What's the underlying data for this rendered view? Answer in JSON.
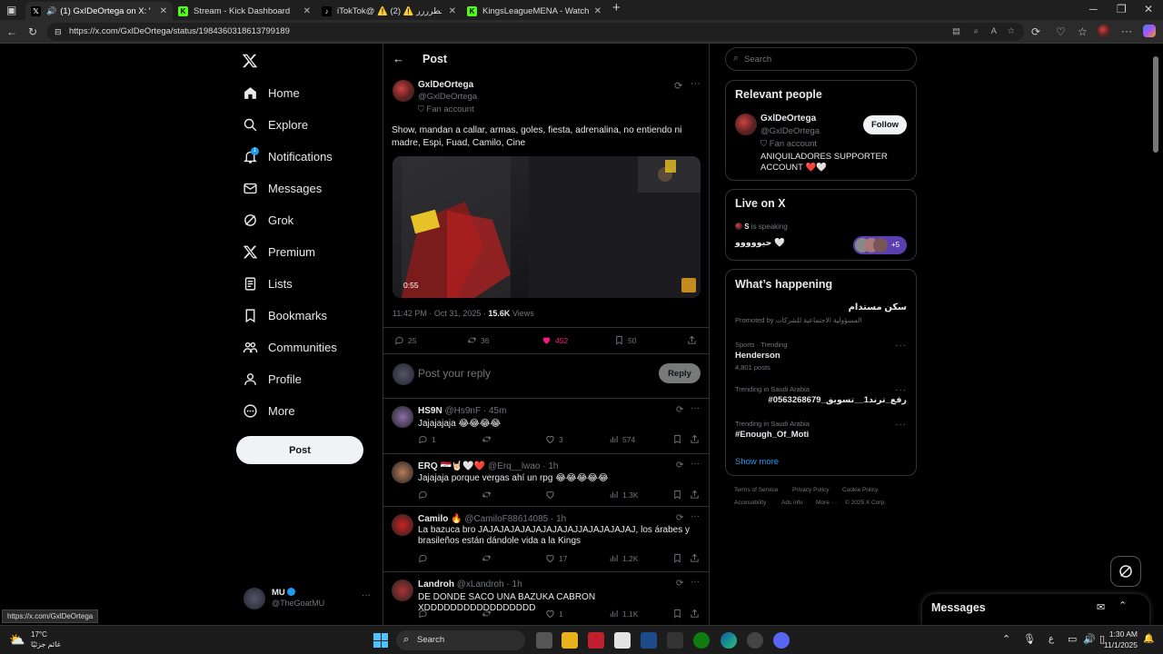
{
  "browser": {
    "tabs": [
      {
        "label": "(1) GxIDeOrtega on X: \"Show",
        "active": true
      },
      {
        "label": "Stream - Kick Dashboard",
        "active": false
      },
      {
        "label": "iTokTok@ ⚠️ يبني انا خطرررر ⚠️ (2)",
        "active": false
      },
      {
        "label": "KingsLeagueMENA - Watch the V",
        "active": false
      }
    ],
    "new_tab": "+",
    "url": "https://x.com/GxlDeOrtega/status/1984360318613799189",
    "status_url": "https://x.com/GxlDeOrtega"
  },
  "nav": {
    "items": [
      {
        "label": "Home",
        "icon": "home-icon"
      },
      {
        "label": "Explore",
        "icon": "search-icon"
      },
      {
        "label": "Notifications",
        "icon": "bell-icon",
        "badge": "1"
      },
      {
        "label": "Messages",
        "icon": "envelope-icon"
      },
      {
        "label": "Grok",
        "icon": "grok-icon"
      },
      {
        "label": "Premium",
        "icon": "x-logo-icon"
      },
      {
        "label": "Lists",
        "icon": "list-icon"
      },
      {
        "label": "Bookmarks",
        "icon": "bookmark-icon"
      },
      {
        "label": "Communities",
        "icon": "people-icon"
      },
      {
        "label": "Profile",
        "icon": "person-icon"
      },
      {
        "label": "More",
        "icon": "more-circle-icon"
      }
    ],
    "post_button": "Post",
    "account": {
      "name": "MU",
      "handle": "@TheGoatMU"
    }
  },
  "post": {
    "header_title": "Post",
    "author_name": "GxlDeOrtega",
    "author_handle": "@GxlDeOrtega",
    "author_tag": "Fan account",
    "text": "Show, mandan a callar, armas, goles, fiesta, adrenalina, no entiendo ni madre, Espi, Fuad, Camilo, Cine",
    "video_time": "0:55",
    "timestamp": "11:42 PM · Oct 31, 2025 · ",
    "views_count": "15.6K",
    "views_label": " Views",
    "replies": "25",
    "reposts": "36",
    "likes": "452",
    "bookmarks": "50",
    "reply_placeholder": "Post your reply",
    "reply_button": "Reply",
    "like_color": "#f91880"
  },
  "replies": [
    {
      "name": "HS9N",
      "handle": "@Hs9nF · 45m",
      "text": "Jajajajaja 😂😂😂😂",
      "replies": "1",
      "reposts": "",
      "likes": "3",
      "views": "574"
    },
    {
      "name": "ERQ 🇮🇶🤘🏻🤍❤️",
      "handle": "@Erq__lwao · 1h",
      "text": "Jajajaja porque vergas ahí un rpg 😂😂😂😂😂",
      "replies": "",
      "reposts": "",
      "likes": "",
      "views": "1.3K"
    },
    {
      "name": "Camilo 🔥",
      "handle": "@CamiloF88614085 · 1h",
      "text": "La bazuca bro JAJAJAJAJAJAJAJAJAJJAJAJAJAJAJ, los árabes y brasileños están dándole vida a la Kings",
      "replies": "",
      "reposts": "",
      "likes": "17",
      "views": "1.2K"
    },
    {
      "name": "Landroh",
      "handle": "@xLandroh · 1h",
      "text": "DE DONDE SACO UNA BAZUKA CABRON XDDDDDDDDDDDDDDDDD",
      "replies": "",
      "reposts": "",
      "likes": "1",
      "views": "1.1K"
    }
  ],
  "sidebar": {
    "search_placeholder": "Search",
    "relevant": {
      "title": "Relevant people",
      "name": "GxlDeOrtega",
      "handle": "@GxlDeOrtega",
      "tag": "Fan account",
      "bio": "ANIQUILADORES SUPPORTER ACCOUNT ❤️🤍",
      "follow": "Follow"
    },
    "live": {
      "title": "Live on X",
      "speaker": "S",
      "speaking": " is speaking",
      "space_title": "حيووووو 🤍",
      "more": "+5"
    },
    "happening": {
      "title": "What’s happening",
      "trends": [
        {
          "meta": "",
          "name": "سكن مستدام",
          "sub": "Promoted by المسؤولية الاجتماعية للشركات"
        },
        {
          "meta": "Sports · Trending",
          "name": "Henderson",
          "sub": "4,801 posts"
        },
        {
          "meta": "Trending in Saudi Arabia",
          "name": "#رفع_ترند1__تسويق_0563268679",
          "sub": ""
        },
        {
          "meta": "Trending in Saudi Arabia",
          "name": "#Enough_Of_Moti",
          "sub": ""
        }
      ],
      "show_more": "Show more"
    },
    "footer": [
      "Terms of Service",
      "Privacy Policy",
      "Cookie Policy",
      "Accessibility",
      "Ads info",
      "More ···",
      "© 2025 X Corp."
    ],
    "messages_title": "Messages"
  },
  "taskbar": {
    "weather_temp": "17°C",
    "weather_text": "غائم جزئيًا",
    "search": "Search",
    "time": "1:30 AM",
    "date": "11/1/2025",
    "lang": "ع"
  }
}
